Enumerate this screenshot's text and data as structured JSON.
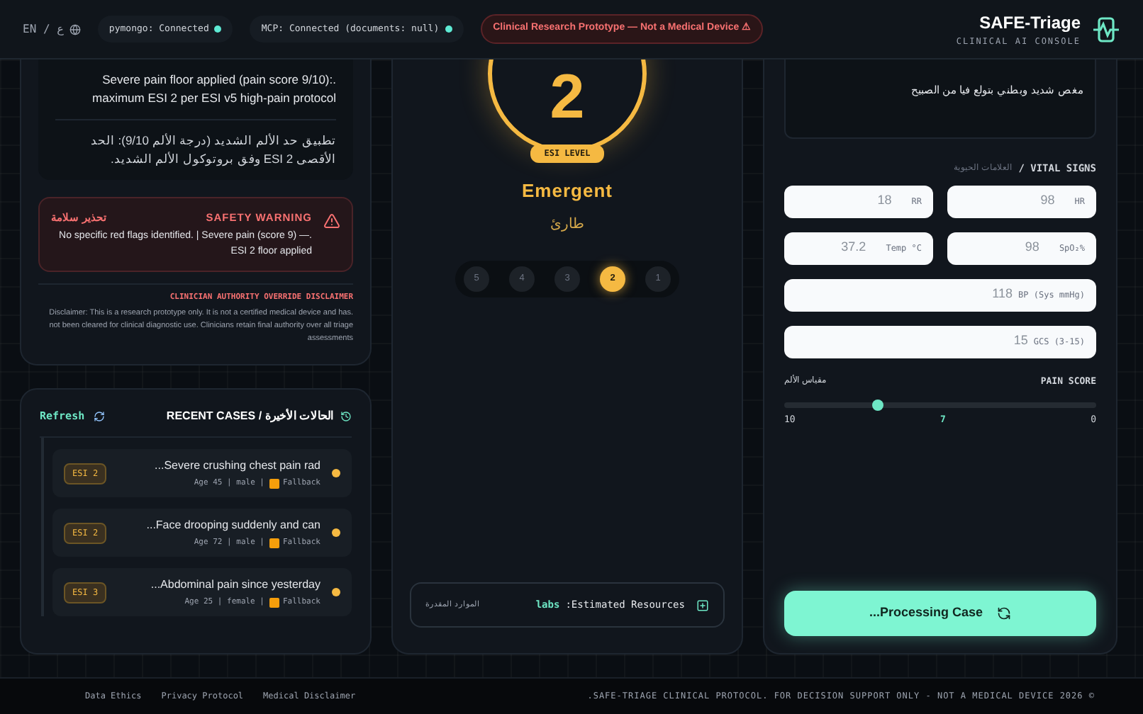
{
  "header": {
    "language": "EN / ع",
    "statuses": [
      {
        "label": "pymongo: Connected",
        "color": "#5eead4"
      },
      {
        "label": "MCP: Connected (documents: null)",
        "color": "#5eead4"
      }
    ],
    "warning_pill": "Clinical Research Prototype — Not a Medical Device ⚠",
    "brand": {
      "title": "SAFE-Triage",
      "subtitle": "CLINICAL AI CONSOLE"
    }
  },
  "rationale": {
    "english": ".Severe pain floor applied (pain score 9/10): maximum ESI 2 per ESI v5 high-pain protocol",
    "arabic": "تطبيق حد الألم الشديد (درجة الألم 9/10): الحد الأقصى ESI 2 وفق بروتوكول الألم الشديد."
  },
  "safety_warning": {
    "title": "SAFETY WARNING",
    "title_ar": "تحذير سلامة",
    "text": ".No specific red flags identified. | Severe pain (score 9) — ESI 2 floor applied"
  },
  "disclaimer": {
    "title": "CLINICIAN AUTHORITY OVERRIDE DISCLAIMER",
    "text": ".Disclaimer: This is a research prototype only. It is not a certified medical device and has not been cleared for clinical diagnostic use. Clinicians retain final authority over all triage assessments"
  },
  "recent_cases": {
    "title": "RECENT CASES / الحالات الأخيرة",
    "refresh": "Refresh",
    "items": [
      {
        "title": "...Severe crushing chest pain rad",
        "meta": "Age 45 | male |",
        "source": "Fallback",
        "badge": "ESI 2",
        "color": "#f5b942"
      },
      {
        "title": "...Face drooping suddenly and can",
        "meta": "Age 72 | male |",
        "source": "Fallback",
        "badge": "ESI 2",
        "color": "#f5b942"
      },
      {
        "title": "...Abdominal pain since yesterday",
        "meta": "Age 25 | female |",
        "source": "Fallback",
        "badge": "ESI 3",
        "color": "#f5b942"
      }
    ]
  },
  "result": {
    "esi_value": "2",
    "badge": "ESI LEVEL",
    "category": "Emergent",
    "category_ar": "طارئ",
    "scale": [
      {
        "label": "5",
        "selected": false
      },
      {
        "label": "4",
        "selected": false
      },
      {
        "label": "3",
        "selected": false
      },
      {
        "label": "2",
        "selected": true
      },
      {
        "label": "1",
        "selected": false
      }
    ],
    "resources": {
      "label": ":Estimated Resources",
      "value": "labs",
      "label_ar": "الموارد المقدرة"
    }
  },
  "intake": {
    "complaint": "مغص شديد وبطني بتولع فيا من الصبيح",
    "vitals_title": "/ VITAL SIGNS",
    "vitals_title_ar": "العلامات الحيوية",
    "vitals": [
      {
        "label": "RR",
        "placeholder": "18",
        "kind": "half"
      },
      {
        "label": "HR",
        "placeholder": "98",
        "kind": "half"
      },
      {
        "label": "Temp °C",
        "placeholder": "37.2",
        "kind": "half"
      },
      {
        "label": "SpO₂%",
        "placeholder": "98",
        "kind": "half"
      },
      {
        "label": "BP (Sys mmHg)",
        "placeholder": "118",
        "kind": "full"
      },
      {
        "label": "GCS (3-15)",
        "placeholder": "15",
        "kind": "full"
      }
    ],
    "pain": {
      "title": "PAIN SCORE",
      "title_ar": "مقياس الألم",
      "min": "0",
      "max": "10",
      "reading": "7"
    },
    "submit": "...Processing Case"
  },
  "footer": {
    "links": [
      "Data Ethics",
      "Privacy Protocol",
      "Medical Disclaimer"
    ],
    "notice": ".SAFE-TRIAGE CLINICAL PROTOCOL. FOR DECISION SUPPORT ONLY - NOT A MEDICAL DEVICE 2026 ©"
  }
}
